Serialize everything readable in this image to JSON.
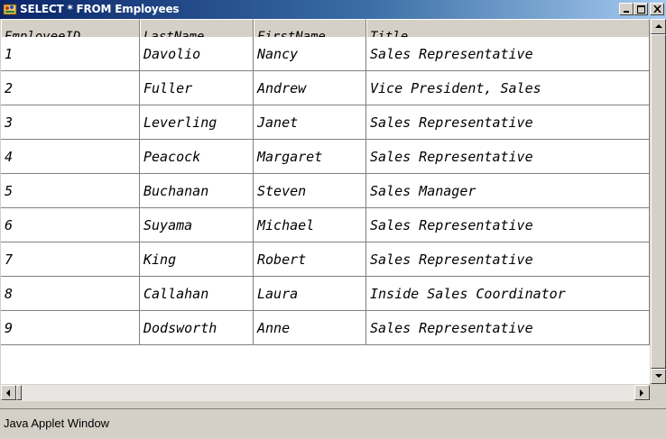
{
  "window": {
    "title": "SELECT * FROM Employees",
    "icon": "java-applet-icon"
  },
  "title_buttons": {
    "minimize": "_",
    "maximize": "□",
    "close": "×"
  },
  "table": {
    "columns": [
      "EmployeeID",
      "LastName",
      "FirstName",
      "Title"
    ],
    "rows": [
      [
        "1",
        "Davolio",
        "Nancy",
        "Sales Representative"
      ],
      [
        "2",
        "Fuller",
        "Andrew",
        "Vice President, Sales"
      ],
      [
        "3",
        "Leverling",
        "Janet",
        "Sales Representative"
      ],
      [
        "4",
        "Peacock",
        "Margaret",
        "Sales Representative"
      ],
      [
        "5",
        "Buchanan",
        "Steven",
        "Sales Manager"
      ],
      [
        "6",
        "Suyama",
        "Michael",
        "Sales Representative"
      ],
      [
        "7",
        "King",
        "Robert",
        "Sales Representative"
      ],
      [
        "8",
        "Callahan",
        "Laura",
        "Inside Sales Coordinator"
      ],
      [
        "9",
        "Dodsworth",
        "Anne",
        "Sales Representative"
      ]
    ]
  },
  "status": {
    "text": "Java Applet Window"
  },
  "colors": {
    "title_start": "#0a246a",
    "title_end": "#a6caf0",
    "chrome": "#d4d0c8",
    "grid": "#808080"
  }
}
